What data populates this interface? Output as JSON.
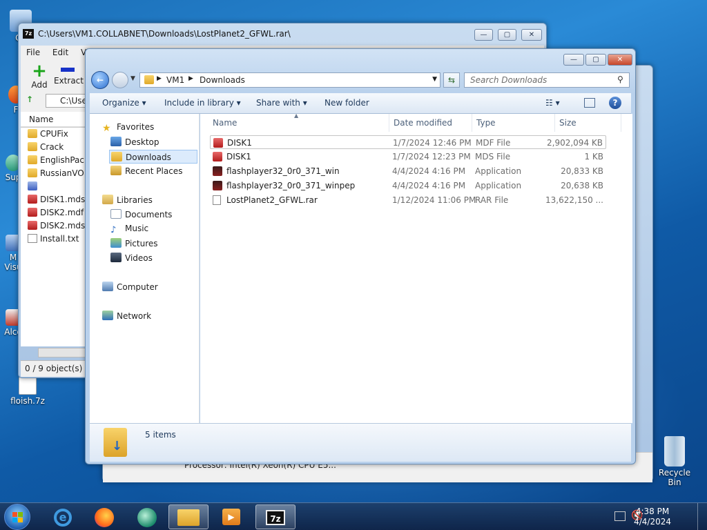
{
  "desktop": {
    "icons": [
      "Co",
      "F",
      "Sup",
      "M Visu",
      "Alco",
      "floish.7z",
      "Recycle Bin"
    ]
  },
  "sevenzip": {
    "title": "C:\\Users\\VM1.COLLABNET\\Downloads\\LostPlanet2_GFWL.rar\\",
    "menu": [
      "File",
      "Edit",
      "View"
    ],
    "add_label": "Add",
    "extract_label": "Extract",
    "path": "C:\\Use",
    "col_name": "Name",
    "items": [
      "CPUFix",
      "Crack",
      "EnglishPack",
      "RussianVO",
      "",
      "DISK1.mds",
      "DISK2.mdf",
      "DISK2.mds",
      "Install.txt"
    ],
    "status": "0 / 9 object(s) se"
  },
  "explorer": {
    "breadcrumb": [
      "VM1",
      "Downloads"
    ],
    "search_placeholder": "Search Downloads",
    "commands": [
      "Organize",
      "Include in library",
      "Share with",
      "New folder"
    ],
    "nav": {
      "favorites": "Favorites",
      "desktop": "Desktop",
      "downloads": "Downloads",
      "recent": "Recent Places",
      "libraries": "Libraries",
      "documents": "Documents",
      "music": "Music",
      "pictures": "Pictures",
      "videos": "Videos",
      "computer": "Computer",
      "network": "Network"
    },
    "columns": [
      "Name",
      "Date modified",
      "Type",
      "Size"
    ],
    "files": [
      {
        "name": "DISK1",
        "date": "1/7/2024 12:46 PM",
        "type": "MDF File",
        "size": "2,902,094 KB"
      },
      {
        "name": "DISK1",
        "date": "1/7/2024 12:23 PM",
        "type": "MDS File",
        "size": "1 KB"
      },
      {
        "name": "flashplayer32_0r0_371_win",
        "date": "4/4/2024 4:16 PM",
        "type": "Application",
        "size": "20,833 KB"
      },
      {
        "name": "flashplayer32_0r0_371_winpep",
        "date": "4/4/2024 4:16 PM",
        "type": "Application",
        "size": "20,638 KB"
      },
      {
        "name": "LostPlanet2_GFWL.rar",
        "date": "1/12/2024 11:06 PM",
        "type": "RAR File",
        "size": "13,622,150 ..."
      }
    ],
    "item_count": "5 items"
  },
  "background_window": {
    "text": "Processor: Intel(R) Xeon(R) CPU E5..."
  },
  "taskbar": {
    "time": "4:38 PM",
    "date": "4/4/2024"
  }
}
